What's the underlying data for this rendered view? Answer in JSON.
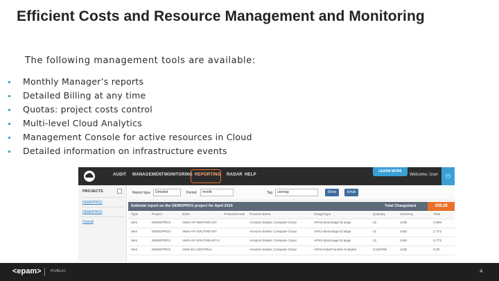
{
  "slide": {
    "title": "Efficient Costs and Resource Management and Monitoring",
    "subtitle": "The following management tools are available:",
    "bullets": [
      "Monthly Manager’s reports",
      "Detailed Billing at any time",
      "Quotas: project costs control",
      "Multi-level Cloud Analytics",
      "Management Console for active resources in Cloud",
      "Detailed information on infrastructure events"
    ]
  },
  "app": {
    "nav": [
      "AUDIT",
      "MANAGEMENT",
      "MONITORING",
      "REPORTING",
      "RADAR",
      "HELP"
    ],
    "active_nav": "REPORTING",
    "learn_more": "LEARN MORE",
    "welcome": "Welcome, User",
    "power_icon": "power-icon",
    "projects": {
      "heading": "PROJECTS",
      "items": [
        "DEMOPRO1",
        "DEMOPRO2",
        "Overall"
      ]
    },
    "filters": {
      "report_type_label": "Report type",
      "report_type_value": "Detailed",
      "period_label": "Period",
      "period_value": "month",
      "tag_label": "Tag",
      "tag_value": "usertag",
      "show_button": "Show",
      "email_button": "Email"
    },
    "report": {
      "title": "Subtotal report on the DEMOPRO1 project for April 2015",
      "chargeback_label": "Total Chargeback",
      "chargeback_value": "208.28"
    },
    "table": {
      "headers": [
        "Type",
        "Project",
        "Zone",
        "ProductsCode",
        "Product Name",
        "UsageType",
        "Quantity",
        "Currency",
        "Total"
      ],
      "rows": [
        [
          "Item",
          "DEMOPRO1",
          "AWS-AP-NORTHEAST",
          "",
          "Amazon Elastic Compute Cloud",
          "APN1-BoxUsage:t2.large",
          "21",
          "USD",
          "2.598"
        ],
        [
          "Item",
          "DEMOPRO1",
          "AWS-AP-SOUTHEAST",
          "",
          "Amazon Elastic Compute Cloud",
          "APS1-BoxUsage:t2.large",
          "21",
          "USD",
          "2.772"
        ],
        [
          "Item",
          "DEMOPRO1",
          "AWS-AP-SOUTHEAST-2",
          "",
          "Amazon Elastic Compute Cloud",
          "APS2-BoxUsage:t2.large",
          "21",
          "USD",
          "2.772"
        ],
        [
          "Item",
          "DEMOPRO1",
          "AWS-EU-CENTRAL",
          "",
          "Amazon Elastic Compute Cloud",
          "APN1-DataTransfer-In-Bytes",
          "0.016789",
          "USD",
          "0.00"
        ]
      ]
    }
  },
  "footer": {
    "logo": "<epam>",
    "label": "PUBLIC",
    "page": "4"
  }
}
